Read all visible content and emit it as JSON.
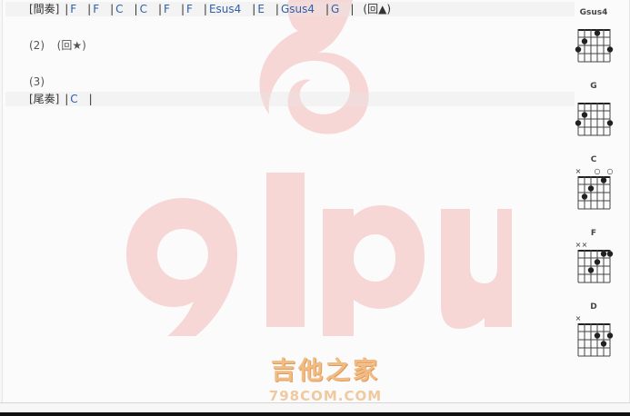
{
  "lines": {
    "interlude": {
      "label": "[間奏]",
      "tokens": [
        {
          "t": "|",
          "c": "bar"
        },
        {
          "t": "F",
          "c": "chord"
        },
        {
          "t": "|",
          "c": "bar"
        },
        {
          "t": "F",
          "c": "chord"
        },
        {
          "t": "|",
          "c": "bar"
        },
        {
          "t": "C",
          "c": "chord"
        },
        {
          "t": "|",
          "c": "bar"
        },
        {
          "t": "C",
          "c": "chord"
        },
        {
          "t": "|",
          "c": "bar"
        },
        {
          "t": "F",
          "c": "chord"
        },
        {
          "t": "|",
          "c": "bar"
        },
        {
          "t": "F",
          "c": "chord"
        },
        {
          "t": "|",
          "c": "bar"
        },
        {
          "t": "Esus4",
          "c": "chord"
        },
        {
          "t": "|",
          "c": "bar"
        },
        {
          "t": "E",
          "c": "chord"
        },
        {
          "t": "|",
          "c": "bar"
        },
        {
          "t": "Gsus4",
          "c": "chord"
        },
        {
          "t": "|",
          "c": "bar"
        },
        {
          "t": "G",
          "c": "chord"
        },
        {
          "t": "|",
          "c": "bar"
        },
        {
          "t": "(回▲)",
          "c": "lbl"
        }
      ]
    },
    "section2": {
      "number": "(2)",
      "repeat": "(回★)"
    },
    "section3": {
      "number": "(3)"
    },
    "outro": {
      "label": "[尾奏]",
      "tokens": [
        {
          "t": "|",
          "c": "bar"
        },
        {
          "t": "C",
          "c": "chord"
        },
        {
          "t": "|",
          "c": "bar"
        }
      ]
    }
  },
  "chord_charts": [
    {
      "name": "Gsus4",
      "markers": [
        "",
        "",
        "",
        "",
        "",
        ""
      ],
      "dots": [
        [
          1,
          3
        ],
        [
          2,
          2
        ],
        [
          4,
          1
        ],
        [
          6,
          3
        ]
      ]
    },
    {
      "name": "G",
      "markers": [
        "",
        "",
        "",
        "",
        "",
        ""
      ],
      "dots": [
        [
          1,
          3
        ],
        [
          2,
          2
        ],
        [
          6,
          3
        ]
      ]
    },
    {
      "name": "C",
      "markers": [
        "×",
        "",
        "",
        "○",
        "",
        "○"
      ],
      "dots": [
        [
          2,
          3
        ],
        [
          3,
          2
        ],
        [
          5,
          1
        ]
      ]
    },
    {
      "name": "F",
      "markers": [
        "×",
        "×",
        "",
        "",
        "",
        ""
      ],
      "dots": [
        [
          3,
          3
        ],
        [
          4,
          2
        ],
        [
          5,
          1
        ],
        [
          6,
          1
        ]
      ]
    },
    {
      "name": "D",
      "markers": [
        "×",
        "",
        "",
        "",
        "",
        ""
      ],
      "dots": [
        [
          4,
          2
        ],
        [
          5,
          3
        ],
        [
          6,
          2
        ]
      ]
    }
  ],
  "watermark": {
    "logo_text": "91pu",
    "site_name": "吉他之家",
    "site_url": "798COM.COM",
    "logo_color": "#f6d3d3"
  }
}
